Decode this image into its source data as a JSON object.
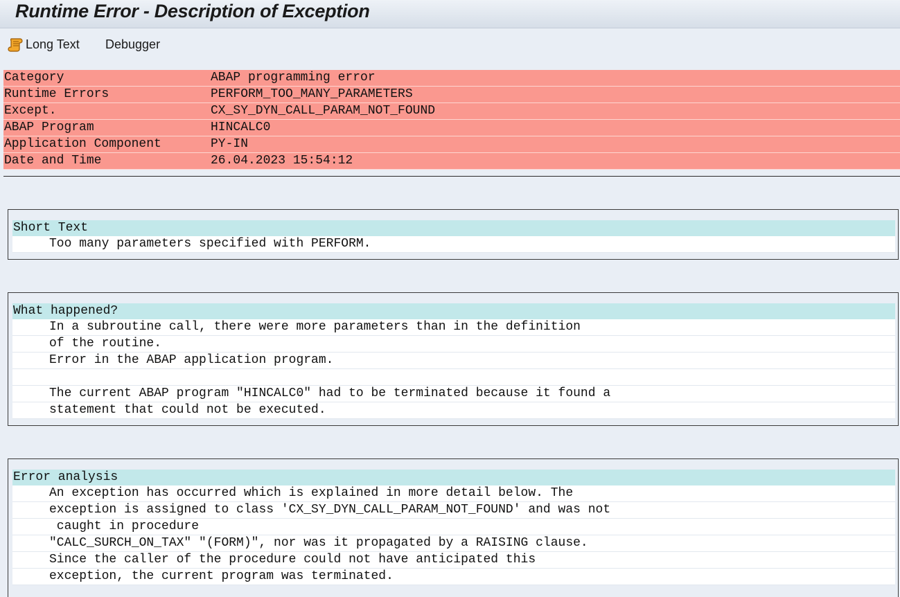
{
  "window": {
    "title": "Runtime Error - Description of Exception"
  },
  "toolbar": {
    "long_text_label": "Long Text",
    "debugger_label": "Debugger"
  },
  "header_rows": [
    {
      "key": "Category",
      "value": "ABAP programming error"
    },
    {
      "key": "Runtime Errors",
      "value": "PERFORM_TOO_MANY_PARAMETERS"
    },
    {
      "key": "Except.",
      "value": "CX_SY_DYN_CALL_PARAM_NOT_FOUND"
    },
    {
      "key": "ABAP Program",
      "value": "HINCALC0"
    },
    {
      "key": "Application Component",
      "value": "PY-IN"
    },
    {
      "key": "Date and Time",
      "value": "26.04.2023 15:54:12"
    }
  ],
  "short_text": {
    "heading": "Short Text",
    "lines": [
      "Too many parameters specified with PERFORM."
    ]
  },
  "what_happened": {
    "heading": "What happened?",
    "lines": [
      "In a subroutine call, there were more parameters than in the definition",
      "of the routine.",
      "Error in the ABAP application program.",
      "",
      "The current ABAP program \"HINCALC0\" had to be terminated because it found a",
      "statement that could not be executed."
    ]
  },
  "error_analysis": {
    "heading": "Error analysis",
    "lines": [
      "An exception has occurred which is explained in more detail below. The",
      "exception is assigned to class 'CX_SY_DYN_CALL_PARAM_NOT_FOUND' and was not",
      " caught in procedure",
      "\"CALC_SURCH_ON_TAX\" \"(FORM)\", nor was it propagated by a RAISING clause.",
      "Since the caller of the procedure could not have anticipated this",
      "exception, the current program was terminated."
    ]
  },
  "colors": {
    "header_row_bg": "#fa988f",
    "section_head_bg": "#c2e8ea",
    "page_bg": "#e9eef5"
  }
}
